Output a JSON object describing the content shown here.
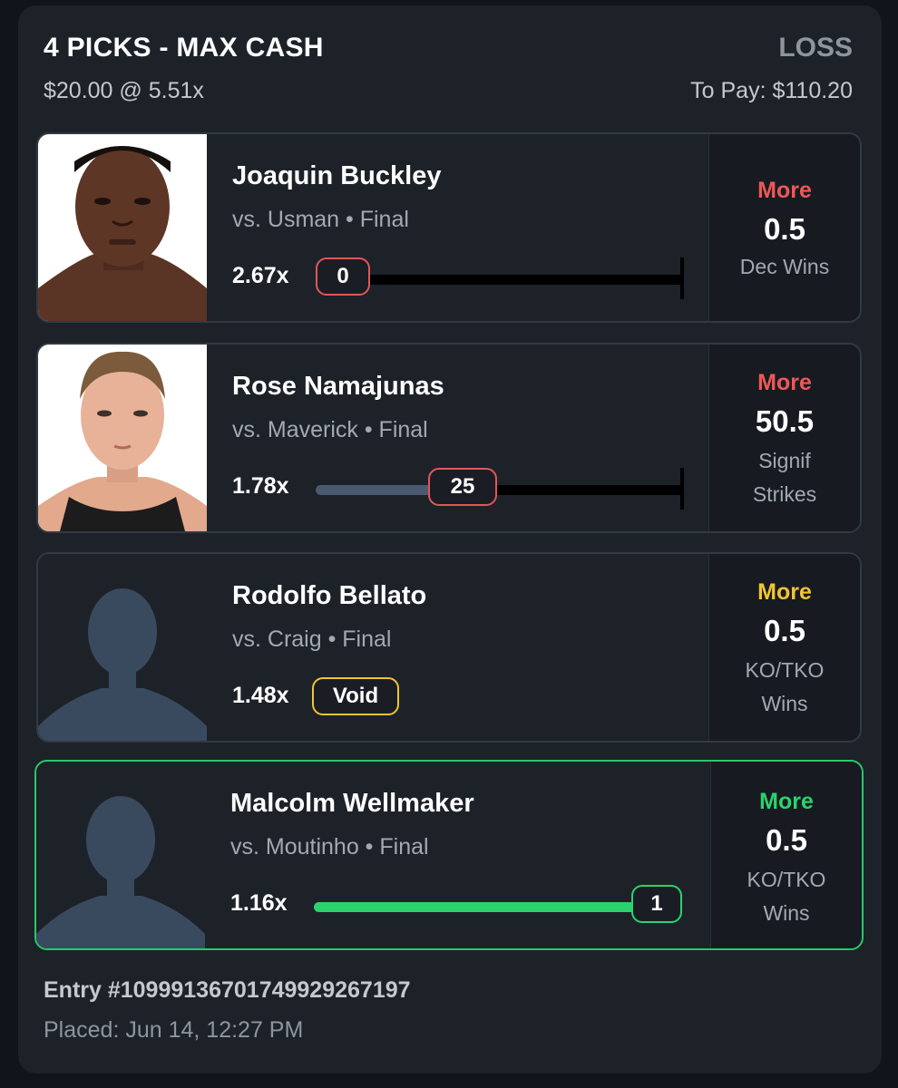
{
  "header": {
    "title": "4 PICKS - MAX CASH",
    "status": "LOSS",
    "stake": "$20.00 @ 5.51x",
    "to_pay": "To Pay: $110.20"
  },
  "picks": [
    {
      "name": "Joaquin Buckley",
      "matchup": "vs. Usman • Final",
      "multiplier": "2.67x",
      "result": "0",
      "direction": "More",
      "line": "0.5",
      "stat": "Dec Wins",
      "progress": 0,
      "state": "lost"
    },
    {
      "name": "Rose Namajunas",
      "matchup": "vs. Maverick • Final",
      "multiplier": "1.78x",
      "result": "25",
      "direction": "More",
      "line": "50.5",
      "stat": "Signif Strikes",
      "progress": 0.49,
      "state": "lost"
    },
    {
      "name": "Rodolfo Bellato",
      "matchup": "vs. Craig • Final",
      "multiplier": "1.48x",
      "result": "Void",
      "direction": "More",
      "line": "0.5",
      "stat": "KO/TKO Wins",
      "state": "void"
    },
    {
      "name": "Malcolm Wellmaker",
      "matchup": "vs. Moutinho • Final",
      "multiplier": "1.16x",
      "result": "1",
      "direction": "More",
      "line": "0.5",
      "stat": "KO/TKO Wins",
      "progress": 1,
      "state": "won"
    }
  ],
  "footer": {
    "entry": "Entry #1099913670174992926​7197",
    "placed": "Placed: Jun 14, 12:27 PM"
  },
  "colors": {
    "lost": "#ef5757",
    "void": "#f2c431",
    "won": "#2bd36e"
  }
}
